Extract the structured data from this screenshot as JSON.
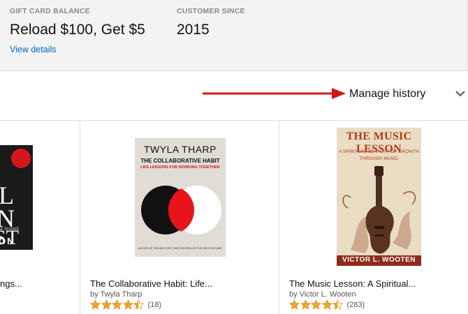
{
  "account": {
    "gift_card": {
      "label": "GIFT CARD BALANCE",
      "value": "Reload $100, Get $5",
      "link": "View details"
    },
    "customer_since": {
      "label": "CUSTOMER SINCE",
      "value": "2015"
    }
  },
  "history": {
    "manage_label": "Manage history"
  },
  "colors": {
    "accent_link": "#0066c0",
    "arrow": "#d4171d",
    "star": "#f5a623"
  },
  "products": [
    {
      "title": "ngs...",
      "cover": {
        "big_lines": [
          "L",
          "N",
          "ST"
        ],
        "small_text": "& SHAWE",
        "name_text": "ON"
      }
    },
    {
      "title": "The Collaborative Habit: Life...",
      "author": "by Twyla Tharp",
      "rating": 4.5,
      "reviews": "(18)",
      "cover": {
        "author_text": "TWYLA THARP",
        "title_text": "THE COLLABORATIVE HABIT",
        "subtitle_text": "LIFE LESSONS FOR WORKING TOGETHER",
        "footer_text": "AUTHOR OF THE NEW YORK TIMES BESTSELLER THE CREATIVE HABIT"
      }
    },
    {
      "title": "The Music Lesson: A Spiritual...",
      "author": "by Victor L. Wooten",
      "rating": 4.5,
      "reviews": "(283)",
      "cover": {
        "title_text": "THE MUSIC LESSON",
        "subtitle_line1": "A SPIRITUAL SEARCH FOR GROWTH",
        "subtitle_line2": "THROUGH MUSIC",
        "name_text": "VICTOR L. WOOTEN"
      }
    }
  ]
}
